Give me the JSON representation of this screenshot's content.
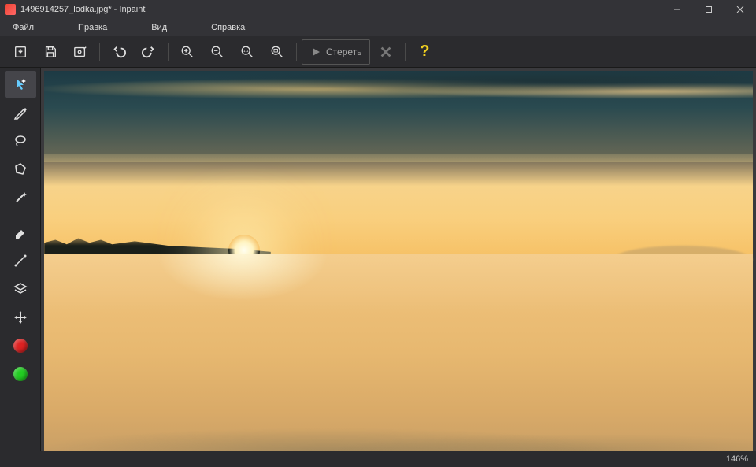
{
  "window": {
    "title": "1496914257_lodka.jpg* - Inpaint"
  },
  "menu": {
    "file": "Файл",
    "edit": "Правка",
    "view": "Вид",
    "help": "Справка"
  },
  "toolbar": {
    "erase_label": "Стереть"
  },
  "status": {
    "zoom": "146%"
  },
  "icons": {
    "open": "open",
    "save": "save",
    "save_as": "save-as",
    "undo": "undo",
    "redo": "redo",
    "zoom_in": "zoom-in",
    "zoom_out": "zoom-out",
    "zoom_actual": "zoom-1to1",
    "zoom_fit": "zoom-fit",
    "run": "play",
    "cancel": "x",
    "hint": "?"
  }
}
